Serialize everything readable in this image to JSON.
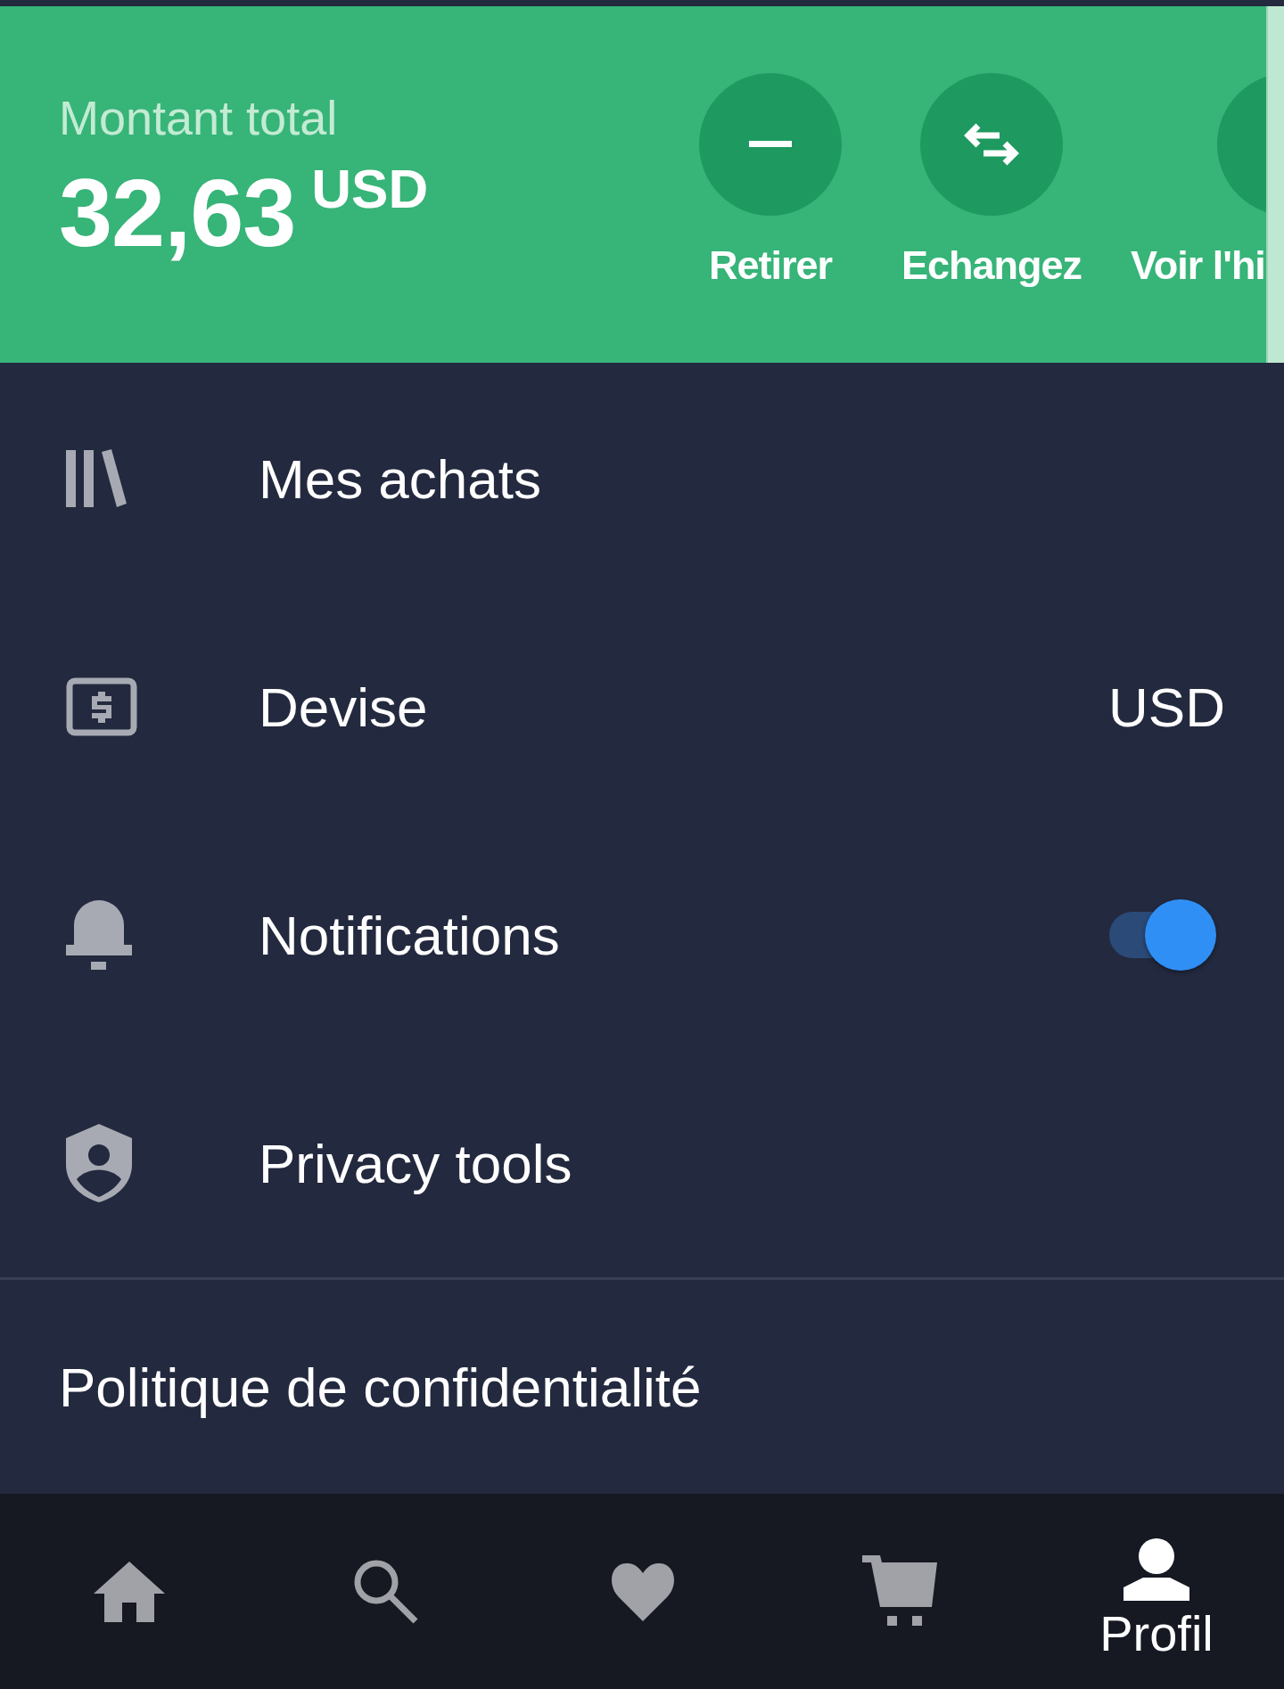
{
  "balance": {
    "label": "Montant total",
    "amount": "32,63",
    "currency": "USD"
  },
  "actions": [
    {
      "label": "Retirer"
    },
    {
      "label": "Echangez"
    },
    {
      "label": "Voir l'hi"
    }
  ],
  "menu": [
    {
      "kind": "link",
      "label": "Mes achats"
    },
    {
      "kind": "value",
      "label": "Devise",
      "value": "USD"
    },
    {
      "kind": "toggle",
      "label": "Notifications",
      "on": true
    },
    {
      "kind": "link",
      "label": "Privacy tools"
    }
  ],
  "privacy_policy": "Politique de confidentialité",
  "bottom_nav": [
    {
      "selected": false
    },
    {
      "selected": false
    },
    {
      "selected": false
    },
    {
      "selected": false
    },
    {
      "label": "Profil",
      "selected": true
    }
  ]
}
